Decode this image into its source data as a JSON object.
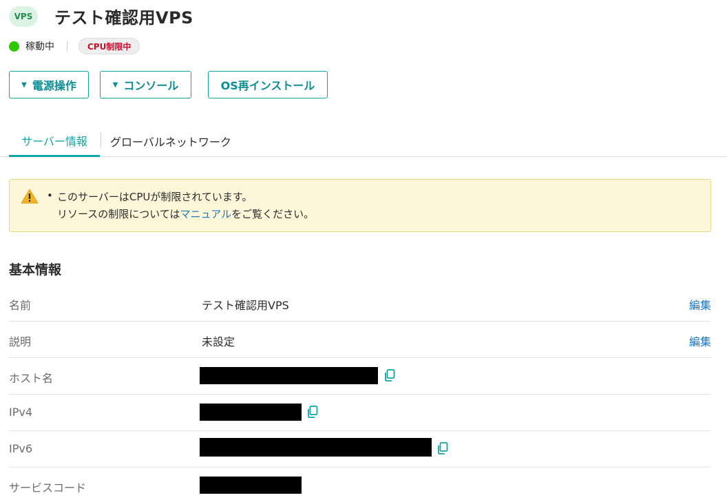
{
  "header": {
    "badge": "VPS",
    "title": "テスト確認用VPS"
  },
  "status": {
    "label": "稼動中",
    "cpu_badge": "CPU制限中",
    "color": "#2ec700"
  },
  "actions": {
    "power": "電源操作",
    "console": "コンソール",
    "reinstall": "OS再インストール"
  },
  "tabs": [
    {
      "label": "サーバー情報",
      "active": true
    },
    {
      "label": "グローバルネットワーク",
      "active": false
    }
  ],
  "alert": {
    "line1": "このサーバーはCPUが制限されています。",
    "line2_pre": "リソースの制限については",
    "line2_link": "マニュアル",
    "line2_post": "をご覧ください。"
  },
  "basic_info": {
    "title": "基本情報",
    "rows": [
      {
        "label": "名前",
        "value": "テスト確認用VPS",
        "action": "編集"
      },
      {
        "label": "説明",
        "value": "未設定",
        "action": "編集"
      },
      {
        "label": "ホスト名",
        "value": ""
      },
      {
        "label": "IPv4",
        "value": ""
      },
      {
        "label": "IPv6",
        "value": ""
      },
      {
        "label": "サービスコード",
        "value": ""
      }
    ]
  },
  "colors": {
    "accent": "#0fa5a5",
    "link": "#1a78c8",
    "alert_bg": "#fdf6d9",
    "danger": "#c8102e"
  }
}
